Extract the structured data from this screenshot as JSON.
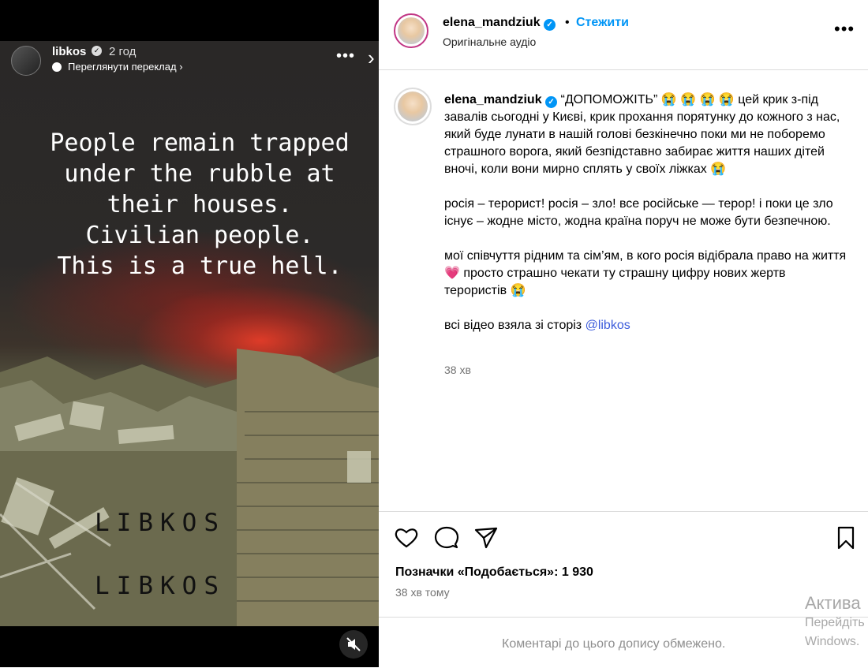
{
  "story": {
    "username": "libkos",
    "time": "2 год",
    "translate_label": "Переглянути переклад ›",
    "overlay_text": "People remain trapped\nunder the rubble at\ntheir houses.\nCivilian people.\nThis is a true hell.",
    "watermark_1": "LIBKOS",
    "watermark_2": "LIBKOS"
  },
  "header": {
    "username": "elena_mandziuk",
    "dot": "•",
    "follow_label": "Стежити",
    "audio_label": "Оригінальне аудіо"
  },
  "caption": {
    "username": "elena_mandziuk",
    "paragraph_1": "“ДОПОМОЖІТЬ” 😭 😭 😭 😭  цей крик з-під завалів сьогодні у Києві, крик прохання порятунку до кожного з нас, який буде лунати в нашій голові безкінечно поки ми не поборемо страшного ворога, який безпідставно забирає життя наших дітей вночі, коли вони мирно сплять у своїх ліжках 😭",
    "paragraph_2": "росія – терорист! росія – зло! все російське — терор! і поки це зло існує – жодне місто, жодна країна поруч не може бути безпечною.",
    "paragraph_3": "мої співчуття рідним та сім’ям, в кого росія відібрала право на життя 💗  просто страшно чекати ту страшну цифру нових жертв терористів 😭",
    "paragraph_4_prefix": "всі відео взяла зі сторіз ",
    "paragraph_4_mention": "@libkos",
    "time": "38 хв"
  },
  "stats": {
    "likes_label": "Позначки «Подобається»: 1 930",
    "posted_ago": "38 хв тому"
  },
  "comments_restricted": "Коментарі до цього допису обмежено.",
  "windows_watermark": {
    "line_1": "Актива",
    "line_2": "Перейдіть",
    "line_3": "Windows."
  }
}
